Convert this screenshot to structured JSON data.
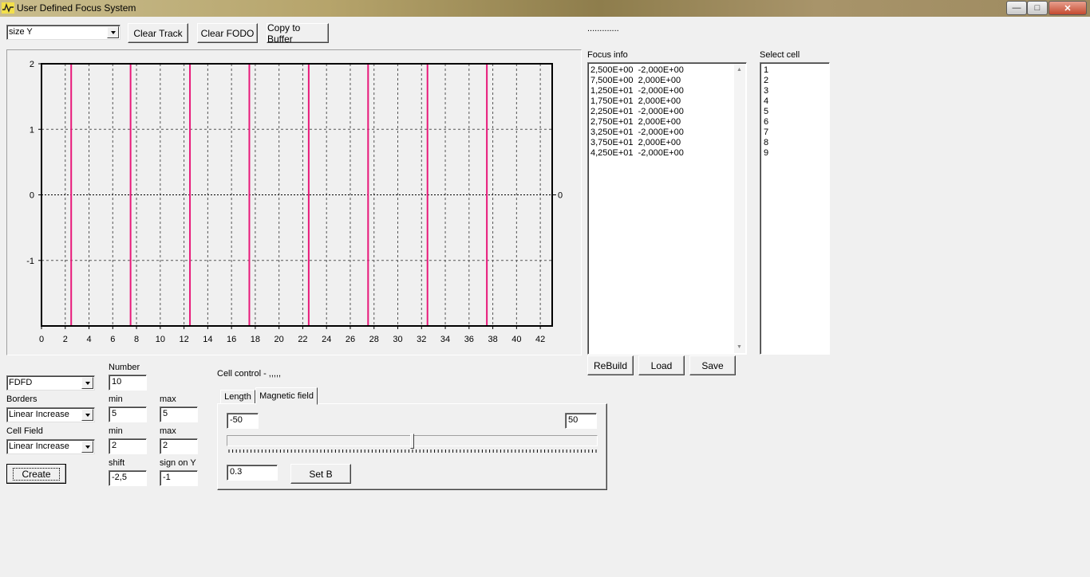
{
  "window": {
    "title": "User Defined Focus System",
    "minimize": "—",
    "maximize": "□",
    "close": "✕"
  },
  "toolbar": {
    "combo_value": "size Y",
    "clear_track": "Clear Track",
    "clear_fodo": "Clear FODO",
    "copy_buffer": "Copy to Buffer",
    "dots": "............."
  },
  "chart_data": {
    "type": "line",
    "x_ticks": [
      0,
      2,
      4,
      6,
      8,
      10,
      12,
      14,
      16,
      18,
      20,
      22,
      24,
      26,
      28,
      30,
      32,
      34,
      36,
      38,
      40,
      42
    ],
    "y_ticks": [
      2,
      1,
      0,
      -1
    ],
    "right_label": "0",
    "xlim": [
      0,
      43
    ],
    "ylim": [
      -2,
      2
    ],
    "grid": true,
    "series": [
      {
        "color": "#e8197a",
        "x": [
          0,
          2.5,
          2.5,
          7.5,
          7.5,
          12.5,
          12.5,
          17.5,
          17.5,
          22.5,
          22.5,
          27.5,
          27.5,
          32.5,
          32.5,
          37.5,
          37.5,
          43
        ],
        "y": [
          -2,
          -2,
          2,
          2,
          -2,
          -2,
          2,
          2,
          -2,
          -2,
          2,
          2,
          -2,
          -2,
          2,
          2,
          -2,
          -2
        ]
      }
    ]
  },
  "focus_info": {
    "label": "Focus info",
    "rows": [
      "2,500E+00  -2,000E+00",
      "7,500E+00  2,000E+00",
      "1,250E+01  -2,000E+00",
      "1,750E+01  2,000E+00",
      "2,250E+01  -2,000E+00",
      "2,750E+01  2,000E+00",
      "3,250E+01  -2,000E+00",
      "3,750E+01  2,000E+00",
      "4,250E+01  -2,000E+00"
    ],
    "rebuild": "ReBuild",
    "load": "Load",
    "save": "Save"
  },
  "select_cell": {
    "label": "Select cell",
    "items": [
      "1",
      "2",
      "3",
      "4",
      "5",
      "6",
      "7",
      "8",
      "9"
    ]
  },
  "left_form": {
    "number_label": "Number",
    "number_value": "10",
    "type_value": "FDFD",
    "borders_label": "Borders",
    "borders_value": "Linear Increase",
    "min_label": "min",
    "max_label": "max",
    "borders_min": "5",
    "borders_max": "5",
    "cellfield_label": "Cell Field",
    "cellfield_value": "Linear Increase",
    "cellfield_min": "2",
    "cellfield_max": "2",
    "shift_label": "shift",
    "shift_value": "-2,5",
    "sign_label": "sign on Y",
    "sign_value": "-1",
    "create": "Create"
  },
  "cell_control": {
    "label": "Cell control - ,,,,,",
    "tabs": [
      "Length",
      "Magnetic field"
    ],
    "min_value": "-50",
    "max_value": "50",
    "slider_position": 0.5,
    "b_value": "0.3",
    "set_b": "Set B"
  }
}
